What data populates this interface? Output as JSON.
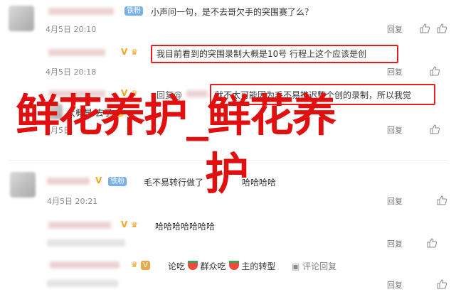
{
  "comments": [
    {
      "text": "小声问一句，是不去哥欠手的突围赛了么？",
      "badge": "铁粉",
      "time": "4月5日 20:10",
      "reply": "回复"
    },
    {
      "text": "我目前看到的突围录制大概是10号 行程上这个应该是创",
      "time": "4月5日 20:18",
      "reply": "回复"
    },
    {
      "prefix": "回复@",
      "text": "就不太可能因为毛不易推迟整个创的录制，所以我觉",
      "reply": "回复"
    },
    {
      "text": "大概是    去了",
      "time": "4月5日",
      "reply": "回复"
    },
    {
      "text": "毛不易转行做了",
      "suffix": "哈哈哈哈",
      "badge": "铁粉",
      "time": "4月5日 20:21",
      "reply": "回复"
    },
    {
      "text": "哈哈哈哈哈哈哈",
      "reply": "回复"
    },
    {
      "text": "论吃",
      "text2": "群众吃",
      "text3": "主的转型",
      "extra": "评论回复",
      "reply": "回复"
    }
  ],
  "overlay": {
    "line1": "鲜花养护_鲜花养",
    "line2": "护"
  },
  "icons": {
    "like": "thumbs-up-icon",
    "vip": "vip-icon",
    "crown": "crown-icon"
  },
  "colors": {
    "overlay": "#e01010",
    "highlight_box": "#e02020",
    "badge": "#7ab0e8"
  }
}
